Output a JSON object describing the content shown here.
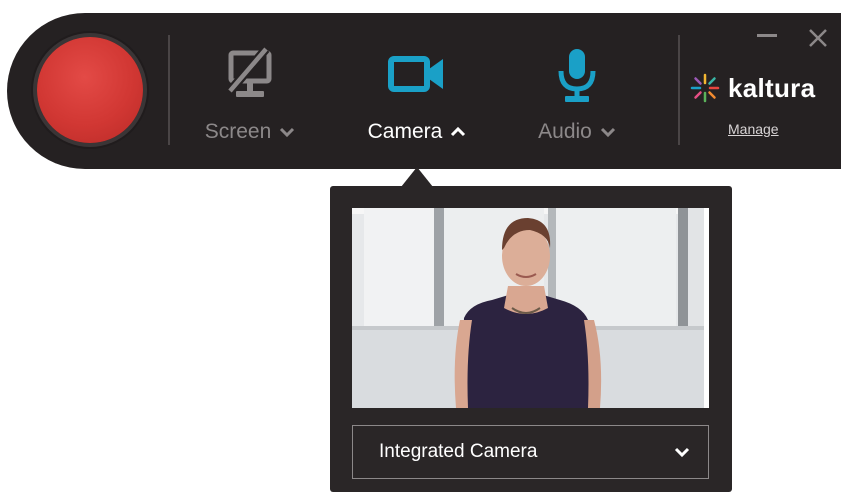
{
  "toolbar": {
    "record_icon": "record-icon",
    "sources": [
      {
        "id": "screen",
        "label": "Screen",
        "icon": "screen-off-icon",
        "active": false
      },
      {
        "id": "camera",
        "label": "Camera",
        "icon": "video-camera-icon",
        "active": true
      },
      {
        "id": "audio",
        "label": "Audio",
        "icon": "microphone-icon",
        "active": false
      }
    ],
    "window_controls": {
      "minimize_icon": "minimize-icon",
      "close_icon": "close-icon"
    },
    "brand": {
      "name": "kaltura",
      "link_label": "Manage"
    }
  },
  "camera_panel": {
    "preview": "webcam-preview",
    "device_selected": "Integrated Camera"
  },
  "colors": {
    "bar_bg": "#252122",
    "panel_bg": "#2a2627",
    "record_red": "#d13733",
    "accent_teal": "#1aa0c7",
    "inactive_icon": "#8c8889",
    "text_white": "#ffffff"
  }
}
